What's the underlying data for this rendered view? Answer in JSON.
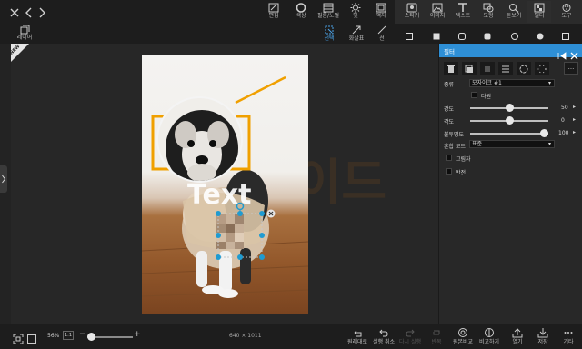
{
  "topbar": {
    "tools": [
      {
        "icon": "edit-icon",
        "label": "편집"
      },
      {
        "icon": "color-icon",
        "label": "색상"
      },
      {
        "icon": "overlay-icon",
        "label": "필름/노멀"
      },
      {
        "icon": "light-icon",
        "label": "빛"
      },
      {
        "icon": "frame-icon",
        "label": "액자"
      }
    ],
    "right_tools": [
      {
        "icon": "sticker-icon",
        "label": "스티커"
      },
      {
        "icon": "image-icon",
        "label": "이미지"
      },
      {
        "icon": "text-icon",
        "label": "텍스트"
      },
      {
        "icon": "shape-icon",
        "label": "도형"
      },
      {
        "icon": "magnify-icon",
        "label": "돋보기"
      },
      {
        "icon": "filter-icon",
        "label": "필터"
      },
      {
        "icon": "tools-icon",
        "label": "도구"
      }
    ]
  },
  "subbar": {
    "tools": [
      {
        "icon": "select-icon",
        "label": "선택"
      },
      {
        "icon": "arrow-line-icon",
        "label": "화살표"
      },
      {
        "icon": "line-icon",
        "label": "선"
      }
    ]
  },
  "leftcol": {
    "layer_label": "레이어",
    "badge": "NEW"
  },
  "canvas": {
    "watermark_text": "가이드",
    "photo_text": "Text"
  },
  "panel": {
    "title": "필터",
    "type_label": "종류",
    "type_value": "모자이크 #1",
    "ellipse_label": "타원",
    "strength_label": "강도",
    "strength_value": "50",
    "strength_fraction": 0.5,
    "angle_label": "각도",
    "angle_value": "0",
    "angle_fraction": 0.5,
    "opacity_label": "불투명도",
    "opacity_value": "100",
    "opacity_fraction": 1.0,
    "blend_label": "혼합 모드",
    "blend_value": "표준",
    "shadow_label": "그림자",
    "invert_label": "반전",
    "more_button": "..."
  },
  "bottombar": {
    "zoom": "56%",
    "zoom_btn": "1:1",
    "image_size": "640 × 1011",
    "actions": [
      {
        "icon": "revert-icon",
        "label": "원래대로",
        "enabled": true
      },
      {
        "icon": "undo-icon",
        "label": "실행 취소",
        "enabled": true
      },
      {
        "icon": "redo-icon",
        "label": "다시 실행",
        "enabled": false
      },
      {
        "icon": "repeat-icon",
        "label": "반복",
        "enabled": false
      },
      {
        "icon": "before-icon",
        "label": "원본비교",
        "enabled": true
      },
      {
        "icon": "compare-icon",
        "label": "비교하기",
        "enabled": true
      },
      {
        "icon": "open-icon",
        "label": "열기",
        "enabled": true
      },
      {
        "icon": "save-icon",
        "label": "저장",
        "enabled": true
      },
      {
        "icon": "more-icon",
        "label": "기타",
        "enabled": true
      }
    ]
  },
  "colors": {
    "accent": "#2e8fd6",
    "arrow": "#f0a000",
    "selection": "#1f9bd1"
  }
}
